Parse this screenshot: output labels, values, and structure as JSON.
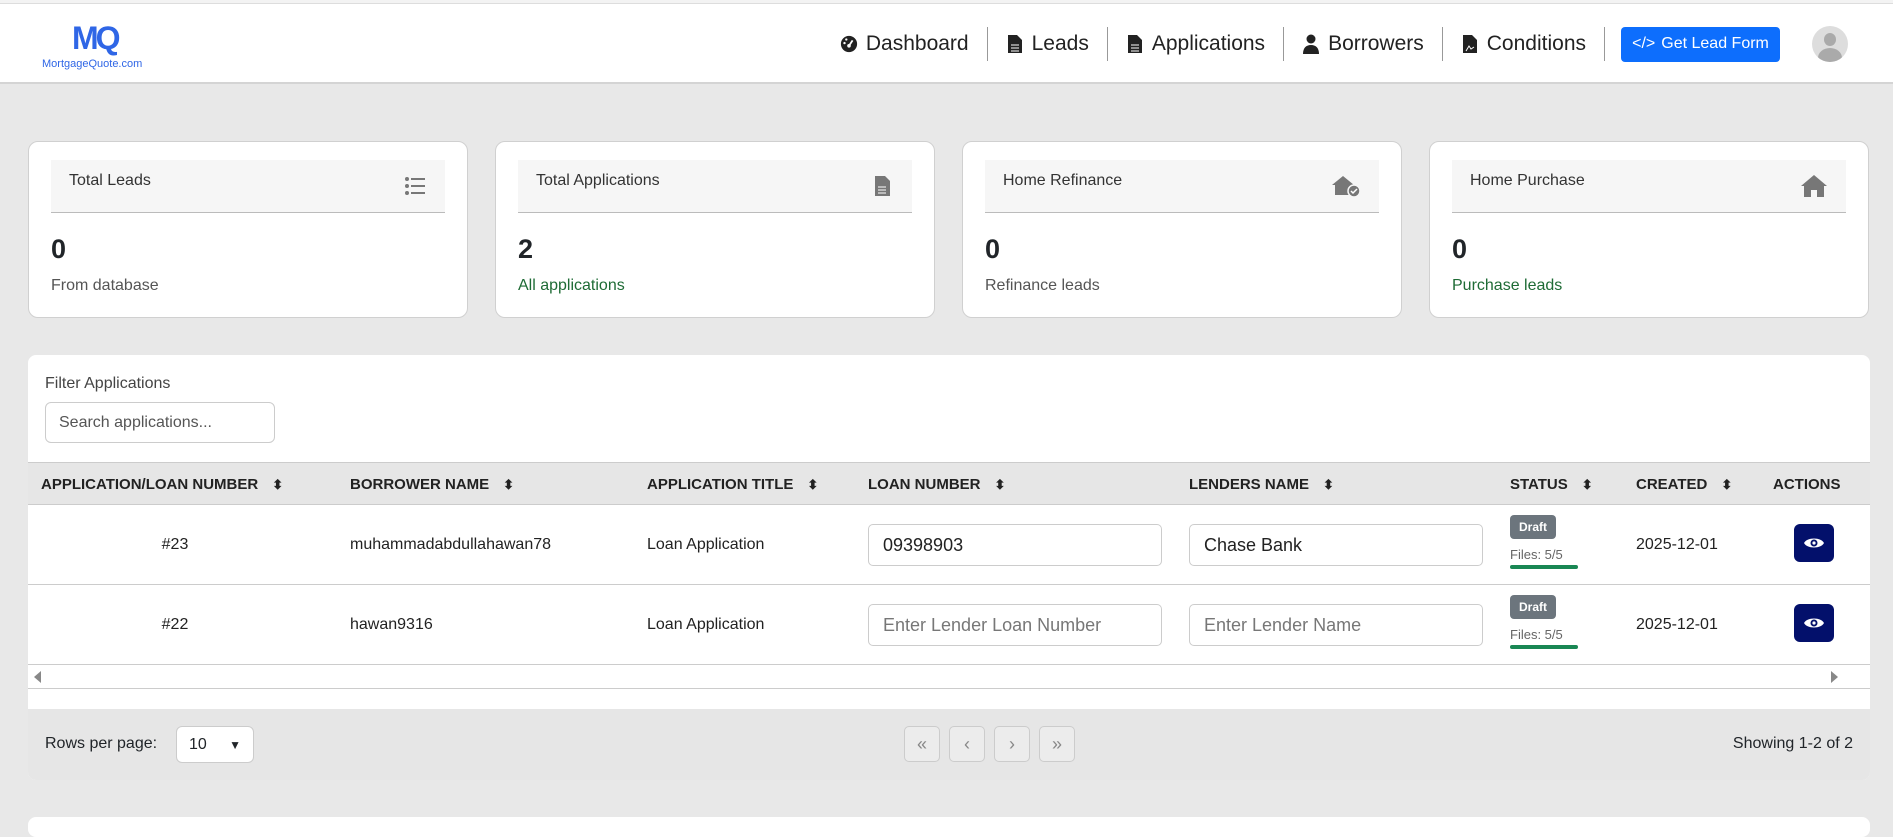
{
  "brand": {
    "logo_mark": "MQ",
    "logo_text": "MortgageQuote.com"
  },
  "nav": {
    "items": [
      {
        "label": "Dashboard",
        "icon": "gauge-icon"
      },
      {
        "label": "Leads",
        "icon": "file-icon"
      },
      {
        "label": "Applications",
        "icon": "file-icon"
      },
      {
        "label": "Borrowers",
        "icon": "user-icon"
      },
      {
        "label": "Conditions",
        "icon": "file-pdf-icon"
      }
    ],
    "cta": "Get Lead Form"
  },
  "cards": [
    {
      "title": "Total Leads",
      "value": "0",
      "sub": "From database"
    },
    {
      "title": "Total Applications",
      "value": "2",
      "sub": "All applications"
    },
    {
      "title": "Home Refinance",
      "value": "0",
      "sub": "Refinance leads"
    },
    {
      "title": "Home Purchase",
      "value": "0",
      "sub": "Purchase leads"
    }
  ],
  "filter": {
    "label": "Filter Applications",
    "placeholder": "Search applications..."
  },
  "table": {
    "headers": [
      "APPLICATION/LOAN NUMBER",
      "BORROWER NAME",
      "APPLICATION TITLE",
      "LOAN NUMBER",
      "LENDERS NAME",
      "STATUS",
      "CREATED",
      "ACTIONS"
    ],
    "loan_placeholder": "Enter Lender Loan Number",
    "lender_placeholder": "Enter Lender Name",
    "rows": [
      {
        "id": "#23",
        "borrower": "muhammadabdullahawan78",
        "title": "Loan Application",
        "loan": "09398903",
        "lender": "Chase Bank",
        "status": "Draft",
        "files": "Files: 5/5",
        "files_progress": 1.0,
        "created": "2025-12-01"
      },
      {
        "id": "#22",
        "borrower": "hawan9316",
        "title": "Loan Application",
        "loan": "",
        "lender": "",
        "status": "Draft",
        "files": "Files: 5/5",
        "files_progress": 1.0,
        "created": "2025-12-01"
      }
    ]
  },
  "pagination": {
    "rows_label": "Rows per page:",
    "rows_value": "10",
    "showing": "Showing 1-2 of 2"
  }
}
